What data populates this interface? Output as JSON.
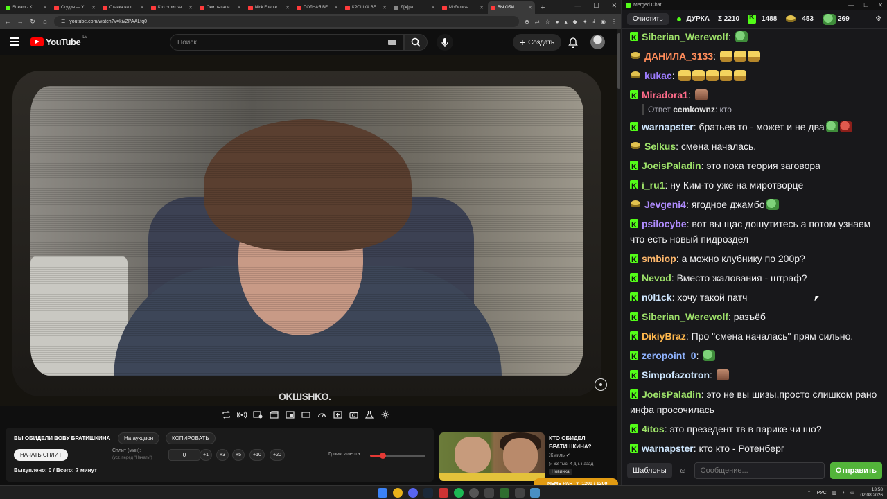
{
  "browser": {
    "tabs": [
      {
        "label": "Stream - Ki",
        "color": "#53fc18",
        "active": false
      },
      {
        "label": "Студия — Y",
        "color": "#ff3b3b",
        "active": false
      },
      {
        "label": "Ставка на п",
        "color": "#ff3b3b",
        "active": false
      },
      {
        "label": "Кто стоит за",
        "color": "#ff3b3b",
        "active": false
      },
      {
        "label": "Они пытали",
        "color": "#ff3b3b",
        "active": false
      },
      {
        "label": "Nick Fuente",
        "color": "#ff3b3b",
        "active": false
      },
      {
        "label": "ПОЛНАЯ ВЕ",
        "color": "#ff3b3b",
        "active": false
      },
      {
        "label": "КРОШКА ВЕ",
        "color": "#ff3b3b",
        "active": false
      },
      {
        "label": "Д[ж]ра",
        "color": "#888888",
        "active": false
      },
      {
        "label": "Мобилиза",
        "color": "#ff3b3b",
        "active": false
      },
      {
        "label": "ВЫ ОБИ",
        "color": "#ff3b3b",
        "active": true
      }
    ],
    "new_tab": "+",
    "url": "youtube.com/watch?v=kivZPAALfq0"
  },
  "youtube": {
    "logo_text": "YouTube",
    "country_code": "LV",
    "search_placeholder": "Поиск",
    "create_label": "Создать",
    "watermark": "OKШSHKO."
  },
  "auction": {
    "title": "ВЫ ОБИДЕЛИ ВОВУ БРАТИШКИНА",
    "on_auction_label": "На аукцион",
    "copy_label": "КОПИРОВАТЬ",
    "start_split_label": "НАЧАТЬ СПЛИТ",
    "split_label": "Сплит (мин):",
    "split_hint": "(уст. перед \"Начать\")",
    "split_value": "0",
    "steps": [
      "+1",
      "+3",
      "+5",
      "+10",
      "+20"
    ],
    "alert_volume_label": "Громк. алерта:",
    "alert_volume_level": 0.22,
    "status": "Выкуплено: 0 / Всего: ? минут"
  },
  "recommendation": {
    "title": "КТО ОБИДЕЛ БРАТИШКИНА?",
    "channel": "Жмиль",
    "stats": "▷ 63 тыс.  4 дн. назад",
    "badge": "Новинка"
  },
  "chat": {
    "window_title": "Merged Chat",
    "clear_label": "Очистить",
    "channel_name": "ДУРКА",
    "total": "Σ 2210",
    "kick_count": "1488",
    "twitch_count": "453",
    "other_count": "269",
    "templates_label": "Шаблоны",
    "input_placeholder": "Сообщение...",
    "send_label": "Отправить",
    "messages": [
      {
        "badge": "k",
        "nick": "Siberian_Werewolf",
        "color": "#9ee26a",
        "text": "",
        "emotes": [
          "frog"
        ]
      },
      {
        "badge": "p",
        "nick": "ДАНИЛА_3133",
        "color": "#ff8c5a",
        "text": "",
        "emotes": [
          "lol",
          "lol",
          "lol"
        ]
      },
      {
        "badge": "p",
        "nick": "kukac",
        "color": "#9d7cff",
        "text": "",
        "emotes": [
          "lol",
          "lol",
          "lol",
          "lol",
          "lol"
        ]
      },
      {
        "badge": "k",
        "nick": "Miradora1",
        "color": "#ff6b8a",
        "text": "",
        "emotes": [
          "face"
        ]
      },
      {
        "reply": true,
        "prefix": "Ответ",
        "nick": "ccmkownz",
        "text": "кто"
      },
      {
        "badge": "k",
        "nick": "warnapster",
        "color": "#cfe7ff",
        "text": "братьев то - может и не два",
        "emotes": [
          "frog",
          "red"
        ]
      },
      {
        "badge": "p",
        "nick": "Selkus",
        "color": "#9ee26a",
        "text": "смена началась.",
        "emotes": []
      },
      {
        "badge": "k",
        "nick": "JoeisPaladin",
        "color": "#9ee26a",
        "text": "это пока теория заговора",
        "emotes": []
      },
      {
        "badge": "k",
        "nick": "i_ru1",
        "color": "#9ee26a",
        "text": "ну Ким-то уже на миротворце",
        "emotes": []
      },
      {
        "badge": "p",
        "nick": "Jevgeni4",
        "color": "#b08cff",
        "text": "ягодное джамбо",
        "emotes": [
          "frog"
        ]
      },
      {
        "badge": "k",
        "nick": "psilocybe",
        "color": "#b08cff",
        "text": "вот вы щас дошутитесь а потом узнаем что есть новый пидроздел",
        "emotes": []
      },
      {
        "badge": "k",
        "nick": "smbiop",
        "color": "#ffb86c",
        "text": "а можно клубнику по 200р?",
        "emotes": []
      },
      {
        "badge": "k",
        "nick": "Nevod",
        "color": "#9ee26a",
        "text": "Вместо жалования - штраф?",
        "emotes": []
      },
      {
        "badge": "k",
        "nick": "n0l1ck",
        "color": "#cfe7ff",
        "text": "хочу такой патч",
        "emotes": []
      },
      {
        "badge": "k",
        "nick": "Siberian_Werewolf",
        "color": "#9ee26a",
        "text": "разъёб",
        "emotes": []
      },
      {
        "badge": "k",
        "nick": "DikiyBraz",
        "color": "#ffb84d",
        "text": "Про \"смена началась\" прям сильно.",
        "emotes": []
      },
      {
        "badge": "k",
        "nick": "zeropoint_0",
        "color": "#8fb3ff",
        "text": "",
        "emotes": [
          "frog"
        ]
      },
      {
        "badge": "k",
        "nick": "Simpofazotron",
        "color": "#cfe7ff",
        "text": "",
        "emotes": [
          "face"
        ]
      },
      {
        "badge": "k",
        "nick": "JoeisPaladin",
        "color": "#9ee26a",
        "text": "это не вы шизы,просто слишком рано инфа просочилась",
        "emotes": []
      },
      {
        "badge": "k",
        "nick": "4itos",
        "color": "#9ee26a",
        "text": "это презедент тв в парике чи шо?",
        "emotes": []
      },
      {
        "badge": "k",
        "nick": "warnapster",
        "color": "#cfe7ff",
        "text": "кто кто - Ротенберг",
        "emotes": []
      }
    ]
  },
  "media_pill": {
    "text": "NEME PARTY",
    "progress_text": "1200 / 1200"
  },
  "taskbar": {
    "lang": "РУС",
    "time": "13:58",
    "date": "02.08.2026"
  },
  "colors": {
    "kick_green": "#53fc18",
    "youtube_red": "#ff0000",
    "send_green": "#53b43a"
  }
}
